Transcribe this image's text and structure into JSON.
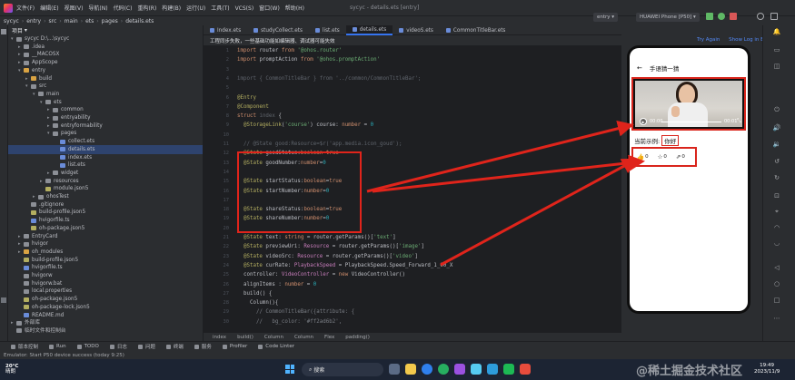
{
  "window": {
    "title": "sycyc - details.ets [entry]",
    "menu": [
      "文件(F)",
      "编辑(E)",
      "视图(V)",
      "导航(N)",
      "代码(C)",
      "重构(R)",
      "构建(B)",
      "运行(U)",
      "工具(T)",
      "VCS(S)",
      "窗口(W)",
      "帮助(H)"
    ]
  },
  "nav": {
    "breadcrumb": [
      "sycyc",
      "entry",
      "src",
      "main",
      "ets",
      "pages",
      "details.ets"
    ],
    "module": "entry",
    "device": "HUAWEI Phone [P50]"
  },
  "project": {
    "header": "项目",
    "rows": [
      {
        "label": "sycyc  D:\\...\\sycyc",
        "indent": 0,
        "arrow": "▾",
        "color": "#8c8f96"
      },
      {
        "label": ".idea",
        "indent": 1,
        "arrow": "▸",
        "color": "#8c8f96"
      },
      {
        "label": "__MACOSX",
        "indent": 1,
        "arrow": "▸",
        "color": "#8c8f96"
      },
      {
        "label": "AppScope",
        "indent": 1,
        "arrow": "▸",
        "color": "#8c8f96"
      },
      {
        "label": "entry",
        "indent": 1,
        "arrow": "▾",
        "color": "#d9a343"
      },
      {
        "label": "build",
        "indent": 2,
        "arrow": "▸",
        "color": "#d9a343"
      },
      {
        "label": "src",
        "indent": 2,
        "arrow": "▾",
        "color": "#8c8f96"
      },
      {
        "label": "main",
        "indent": 3,
        "arrow": "▾",
        "color": "#8c8f96"
      },
      {
        "label": "ets",
        "indent": 4,
        "arrow": "▾",
        "color": "#8c8f96"
      },
      {
        "label": "common",
        "indent": 5,
        "arrow": "▸",
        "color": "#8c8f96"
      },
      {
        "label": "entryability",
        "indent": 5,
        "arrow": "▸",
        "color": "#8c8f96"
      },
      {
        "label": "entryformability",
        "indent": 5,
        "arrow": "▸",
        "color": "#8c8f96"
      },
      {
        "label": "pages",
        "indent": 5,
        "arrow": "▾",
        "color": "#8c8f96"
      },
      {
        "label": "collect.ets",
        "indent": 6,
        "arrow": "",
        "color": "#6a8cd9"
      },
      {
        "label": "details.ets",
        "indent": 6,
        "arrow": "",
        "color": "#6a8cd9",
        "selected": true
      },
      {
        "label": "index.ets",
        "indent": 6,
        "arrow": "",
        "color": "#6a8cd9"
      },
      {
        "label": "list.ets",
        "indent": 6,
        "arrow": "",
        "color": "#6a8cd9"
      },
      {
        "label": "widget",
        "indent": 5,
        "arrow": "▸",
        "color": "#8c8f96"
      },
      {
        "label": "resources",
        "indent": 4,
        "arrow": "▸",
        "color": "#8c8f96"
      },
      {
        "label": "module.json5",
        "indent": 4,
        "arrow": "",
        "color": "#b3ae60"
      },
      {
        "label": "ohosTest",
        "indent": 3,
        "arrow": "▸",
        "color": "#8c8f96"
      },
      {
        "label": ".gitignore",
        "indent": 2,
        "arrow": "",
        "color": "#8c8f96"
      },
      {
        "label": "build-profile.json5",
        "indent": 2,
        "arrow": "",
        "color": "#b3ae60"
      },
      {
        "label": "hvigorfile.ts",
        "indent": 2,
        "arrow": "",
        "color": "#6a8cd9"
      },
      {
        "label": "oh-package.json5",
        "indent": 2,
        "arrow": "",
        "color": "#b3ae60"
      },
      {
        "label": "EntryCard",
        "indent": 1,
        "arrow": "▸",
        "color": "#8c8f96"
      },
      {
        "label": "hvigor",
        "indent": 1,
        "arrow": "▸",
        "color": "#8c8f96"
      },
      {
        "label": "oh_modules",
        "indent": 1,
        "arrow": "▸",
        "color": "#d9a343"
      },
      {
        "label": "build-profile.json5",
        "indent": 1,
        "arrow": "",
        "color": "#b3ae60"
      },
      {
        "label": "hvigorfile.ts",
        "indent": 1,
        "arrow": "",
        "color": "#6a8cd9"
      },
      {
        "label": "hvigorw",
        "indent": 1,
        "arrow": "",
        "color": "#8c8f96"
      },
      {
        "label": "hvigorw.bat",
        "indent": 1,
        "arrow": "",
        "color": "#8c8f96"
      },
      {
        "label": "local.properties",
        "indent": 1,
        "arrow": "",
        "color": "#8c8f96"
      },
      {
        "label": "oh-package.json5",
        "indent": 1,
        "arrow": "",
        "color": "#b3ae60"
      },
      {
        "label": "oh-package-lock.json5",
        "indent": 1,
        "arrow": "",
        "color": "#b3ae60"
      },
      {
        "label": "README.md",
        "indent": 1,
        "arrow": "",
        "color": "#6a8cd9"
      },
      {
        "label": "外部库",
        "indent": 0,
        "arrow": "▸",
        "color": "#8c8f96"
      },
      {
        "label": "临时文件和控制台",
        "indent": 0,
        "arrow": "",
        "color": "#8c8f96"
      }
    ]
  },
  "tabs": [
    {
      "label": "Index.ets"
    },
    {
      "label": "studyCollect.ets"
    },
    {
      "label": "list.ets"
    },
    {
      "label": "details.ets",
      "active": true
    },
    {
      "label": "videoS.ets"
    },
    {
      "label": "CommonTitleBar.ets"
    }
  ],
  "notice": {
    "text": "工程同步失败，一些基础功能如编辑器、调试器可能失效",
    "try_again": "Try Again",
    "show_log": "Show Log in Explorer"
  },
  "code": {
    "lines": [
      {
        "n": "1",
        "html": "<span class='kw'>import</span> router <span class='kw'>from</span> <span class='str'>'@ohos.router'</span>"
      },
      {
        "n": "2",
        "html": "<span class='kw'>import</span> promptAction <span class='kw'>from</span> <span class='str'>'@ohos.promptAction'</span>"
      },
      {
        "n": "3",
        "html": ""
      },
      {
        "n": "4",
        "html": "<span class='dim'>import { CommonTitleBar } from '../common/CommonTitleBar';</span>"
      },
      {
        "n": "5",
        "html": ""
      },
      {
        "n": "6",
        "html": "<span class='dec'>@Entry</span>"
      },
      {
        "n": "7",
        "html": "<span class='dec'>@Component</span>"
      },
      {
        "n": "8",
        "html": "<span class='kw'>struct</span> <span class='dim'>index</span> {"
      },
      {
        "n": "9",
        "html": "  <span class='dec'>@StorageLink</span>(<span class='str'>'course'</span>) course: <span class='kw'>number</span> = <span class='num'>0</span>"
      },
      {
        "n": "10",
        "html": ""
      },
      {
        "n": "11",
        "html": "  <span class='dim'>// @State good:Resource=$r('app.media.icon_goud');</span>"
      },
      {
        "n": "12",
        "html": "  <span class='dec'>@State</span> goodStatus:<span class='kw'>boolean</span>=<span class='kw'>true</span>"
      },
      {
        "n": "13",
        "html": "  <span class='dec'>@State</span> goodNumber:<span class='kw'>number</span>=<span class='num'>0</span>"
      },
      {
        "n": "14",
        "html": ""
      },
      {
        "n": "15",
        "html": "  <span class='dec'>@State</span> startStatus:<span class='kw'>boolean</span>=<span class='kw'>true</span>"
      },
      {
        "n": "16",
        "html": "  <span class='dec'>@State</span> startNumber:<span class='kw'>number</span>=<span class='num'>0</span>"
      },
      {
        "n": "17",
        "html": ""
      },
      {
        "n": "18",
        "html": "  <span class='dec'>@State</span> shareStatus:<span class='kw'>boolean</span>=<span class='kw'>true</span>"
      },
      {
        "n": "19",
        "html": "  <span class='dec'>@State</span> shareNumber:<span class='kw'>number</span>=<span class='num'>0</span>"
      },
      {
        "n": "20",
        "html": ""
      },
      {
        "n": "21",
        "html": "  <span class='dec'>@State</span> text: <span class='kw'>string</span> = router.getParams()[<span class='str'>'text'</span>]"
      },
      {
        "n": "22",
        "html": "  <span class='dec'>@State</span> previewUri: <span class='typ'>Resource</span> = router.getParams()[<span class='str'>'image'</span>]"
      },
      {
        "n": "23",
        "html": "  <span class='dec'>@State</span> videoSrc: <span class='typ'>Resource</span> = router.getParams()[<span class='str'>'video'</span>]"
      },
      {
        "n": "24",
        "html": "  <span class='dec'>@State</span> curRate: <span class='typ'>PlaybackSpeed</span> = PlaybackSpeed.Speed_Forward_1_00_X"
      },
      {
        "n": "25",
        "html": "  controller: <span class='typ'>VideoController</span> = <span class='kw'>new</span> VideoController()"
      },
      {
        "n": "26",
        "html": "  alignItems : <span class='kw'>number</span> = <span class='num'>0</span>"
      },
      {
        "n": "27",
        "html": "  build() {"
      },
      {
        "n": "28",
        "html": "    Column(){"
      },
      {
        "n": "29",
        "html": "      <span class='cmt'>// CommonTitleBar({attribute: {</span>"
      },
      {
        "n": "30",
        "html": "      <span class='cmt'>//   bg_color: '#ff2ad6b2',</span>"
      }
    ]
  },
  "editor_breadcrumb": [
    "index",
    "build()",
    "Column",
    "Column",
    "Flex",
    "padding()"
  ],
  "preview": {
    "title": "手语猜一猜",
    "back_icon": "←",
    "video_time_start": "00:00",
    "video_time_end": "00:01",
    "example_label": "当前示例:",
    "example_value": "你好",
    "good_count": "0",
    "star_count": "0",
    "share_count": "0"
  },
  "bottom_tools": [
    "版本控制",
    "Run",
    "TODO",
    "日志",
    "问题",
    "终端",
    "服务",
    "Profiler",
    "Code Linter"
  ],
  "status": "Emulator: Start P50 device success (today 9:25)",
  "taskbar": {
    "temp": "20°C",
    "weather": "晴朗",
    "search": "搜索",
    "time": "19:49",
    "date": "2023/11/9"
  },
  "watermark": "@稀土掘金技术社区",
  "colors": {
    "accent": "#3574f0",
    "annotation": "#e0241b",
    "editor_bg": "#1e1f22"
  }
}
